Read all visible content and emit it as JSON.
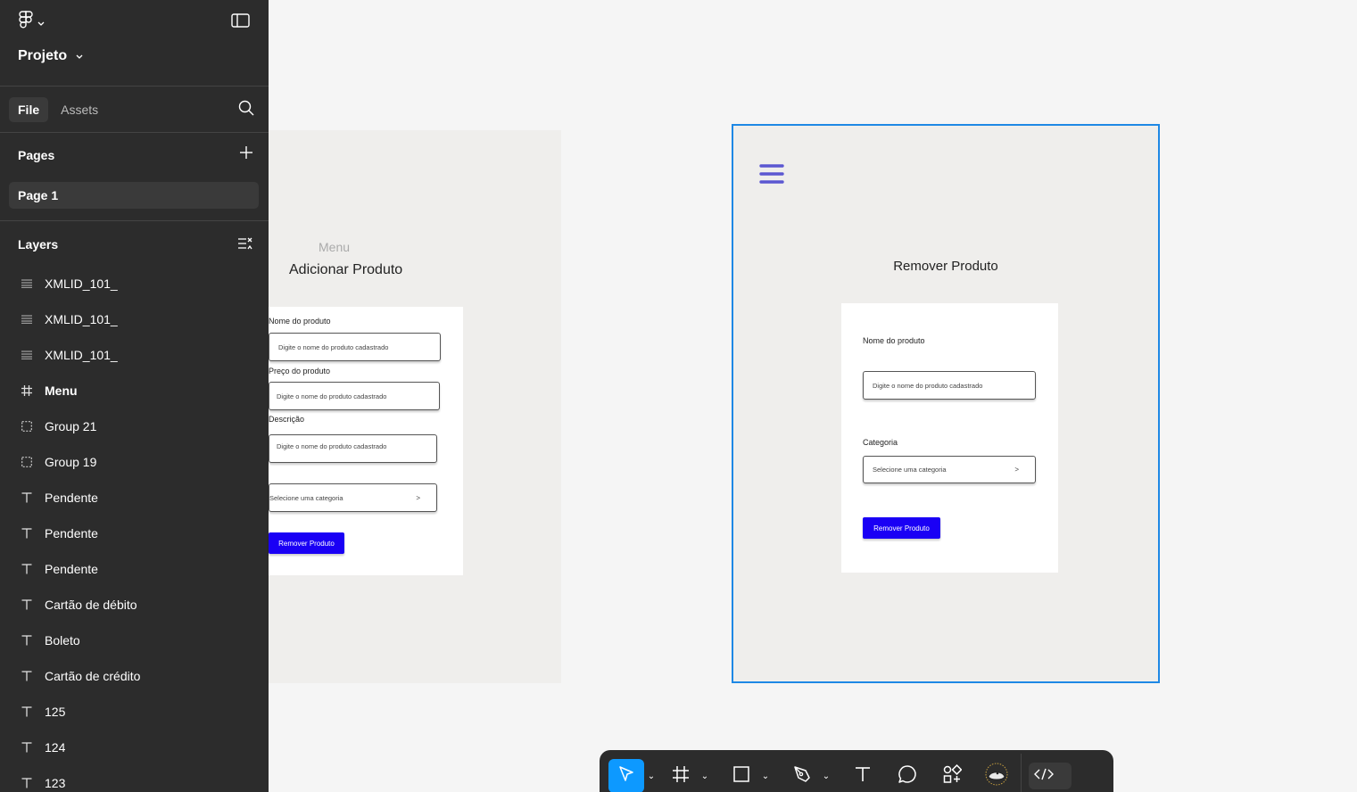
{
  "project": {
    "name": "Projeto"
  },
  "tabs": [
    {
      "label": "File"
    },
    {
      "label": "Assets"
    }
  ],
  "pages": {
    "title": "Pages",
    "items": [
      {
        "label": "Page 1"
      }
    ]
  },
  "layers": {
    "title": "Layers",
    "items": [
      {
        "label": "XMLID_101_",
        "icon": "group-lines-icon"
      },
      {
        "label": "XMLID_101_",
        "icon": "group-lines-icon"
      },
      {
        "label": "XMLID_101_",
        "icon": "group-lines-icon"
      },
      {
        "label": "Menu",
        "icon": "frame-icon"
      },
      {
        "label": "Group 21",
        "icon": "group-icon"
      },
      {
        "label": "Group 19",
        "icon": "group-icon"
      },
      {
        "label": "Pendente",
        "icon": "text-icon"
      },
      {
        "label": "Pendente",
        "icon": "text-icon"
      },
      {
        "label": "Pendente",
        "icon": "text-icon"
      },
      {
        "label": "Cartão de débito",
        "icon": "text-icon"
      },
      {
        "label": "Boleto",
        "icon": "text-icon"
      },
      {
        "label": "Cartão de crédito",
        "icon": "text-icon"
      },
      {
        "label": "125",
        "icon": "text-icon"
      },
      {
        "label": "124",
        "icon": "text-icon"
      },
      {
        "label": "123",
        "icon": "text-icon"
      }
    ]
  },
  "left_frame": {
    "menu_label": "Menu",
    "title": "Adicionar Produto",
    "name_label": "Nome do produto",
    "name_placeholder": "Digite o nome do produto cadastrado",
    "price_label": "Preço do produto",
    "price_placeholder": "Digite o nome do produto cadastrado",
    "desc_label": "Descrição",
    "desc_placeholder": "Digite o nome do produto cadastrado",
    "category_placeholder": "Selecione uma categoria",
    "category_chevron": ">",
    "button": "Remover Produto"
  },
  "right_frame": {
    "title": "Remover Produto",
    "name_label": "Nome do produto",
    "name_placeholder": "Digite o nome do produto cadastrado",
    "category_label": "Categoria",
    "category_placeholder": "Selecione uma categoria",
    "category_chevron": ">",
    "button": "Remover Produto"
  },
  "colors": {
    "accent": "#0d99ff",
    "selection": "#1e88e5",
    "button": "#1a00f5",
    "menu_icon": "#5b57d1"
  }
}
